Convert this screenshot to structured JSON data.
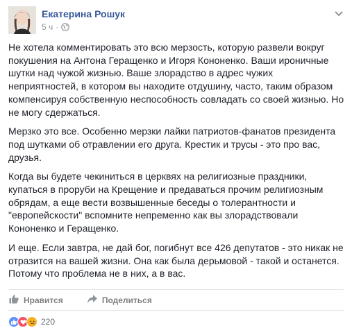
{
  "author": {
    "name": "Екатерина Рошук"
  },
  "meta": {
    "time": "5 ч",
    "separator": "·",
    "privacy_icon": "globe-icon"
  },
  "post": {
    "paragraphs": [
      "Не хотела комментировать это всю мерзость, которую развели вокруг покушения на Антона Геращенко и Игоря Кононенко. Ваши ироничные шутки над чужой жизнью. Ваше злорадство в адрес чужих неприятностей, в котором вы находите отдушину, часто, таким образом компенсируя собственную неспособность совладать со своей жизнью. Но не могу сдержаться.",
      "Мерзко это все. Особенно мерзки лайки патриотов-фанатов президента под шутками об отравлении его друга. Крестик и трусы - это про вас, друзья.",
      "Когда вы будете чекиниться в церквях на религиозные праздники, купаться в проруби на Крещение и предаваться прочим религиозным обрядам, а еще вести возвышенные беседы о толерантности и \"европейскости\" вспомните непременно как вы злорадствовали Кононенко и Геращенко.",
      "И еще. Если завтра, не дай бог, погибнут все 426 депутатов - это никак не отразится на вашей жизни. Она как была дерьмовой - такой и останется. Потому что проблема не в них, а в вас."
    ]
  },
  "actions": {
    "like_label": "Нравится",
    "share_label": "Поделиться"
  },
  "reactions": {
    "count": "220",
    "icons": [
      "like-icon",
      "love-icon",
      "sad-icon"
    ]
  },
  "colors": {
    "link": "#365899",
    "muted": "#90949c",
    "like": "#5890ff",
    "love": "#f25268",
    "sad": "#f7b125"
  }
}
